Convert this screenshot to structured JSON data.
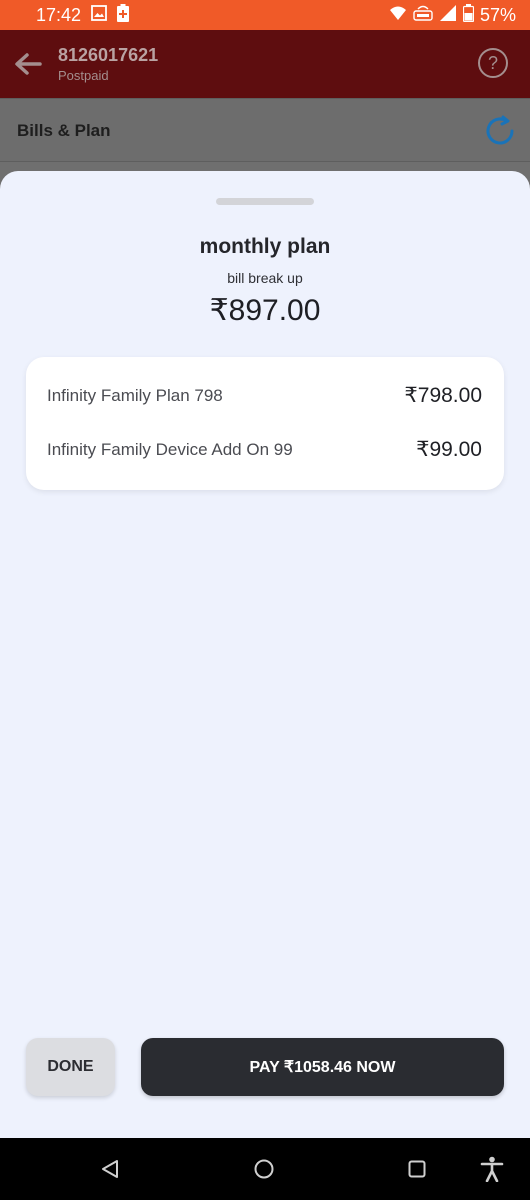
{
  "status_bar": {
    "time": "17:42",
    "battery_percent": "57%",
    "icons": [
      "image-icon",
      "battery-saver-icon",
      "wifi-icon",
      "volte-icon",
      "signal-icon",
      "battery-icon"
    ]
  },
  "header": {
    "phone_number": "8126017621",
    "plan_type": "Postpaid",
    "help_label": "?"
  },
  "bills_section": {
    "title": "Bills & Plan"
  },
  "sheet": {
    "title": "monthly plan",
    "subtitle": "bill break up",
    "total": "₹897.00",
    "items": [
      {
        "label": "Infinity Family Plan 798",
        "amount": "₹798.00"
      },
      {
        "label": "Infinity Family Device Add On 99",
        "amount": "₹99.00"
      }
    ],
    "done_label": "DONE",
    "pay_label": "PAY ₹1058.46 NOW"
  },
  "colors": {
    "status_bar": "#f05a28",
    "header_dimmed": "#5e0d0f",
    "sheet_bg": "#eef2fd",
    "pay_button": "#2a2c31",
    "refresh_accent": "#1a73b8"
  }
}
